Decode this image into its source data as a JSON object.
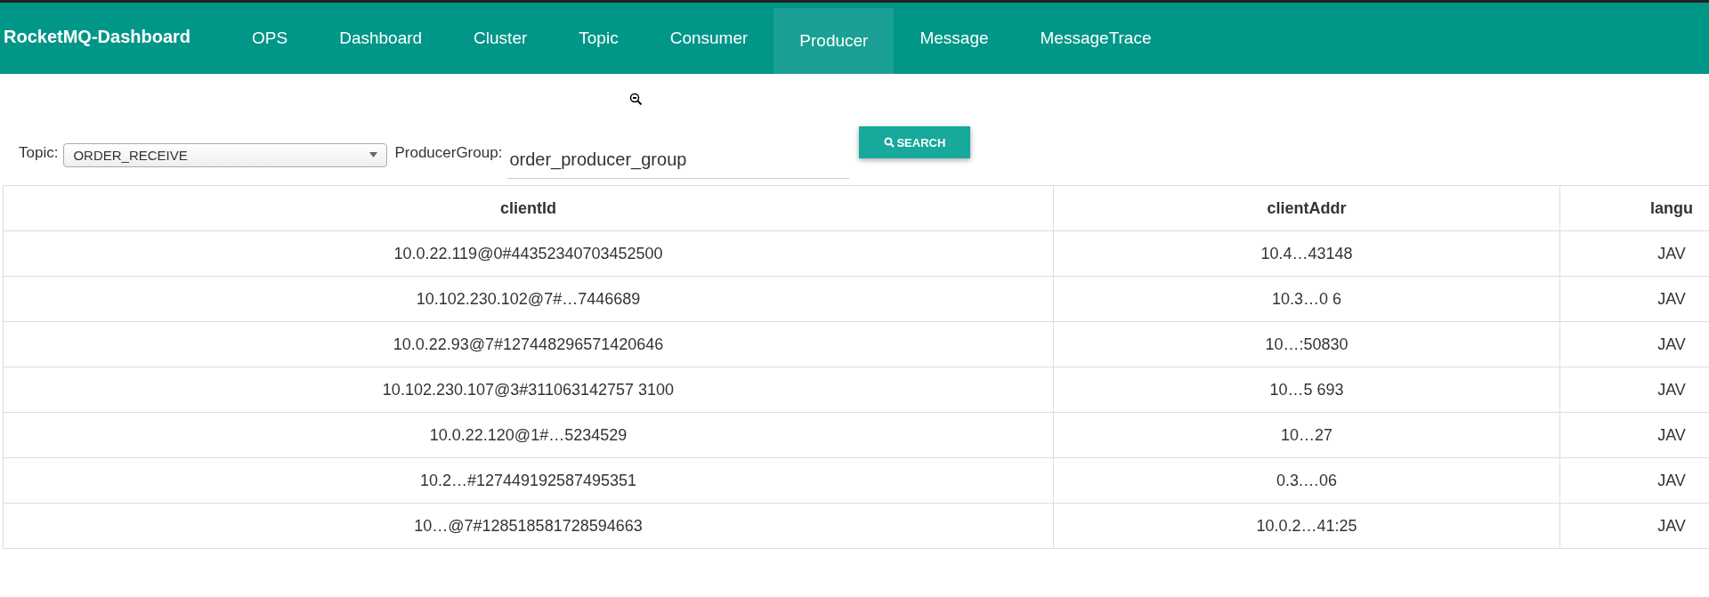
{
  "navbar": {
    "brand": "RocketMQ-Dashboard",
    "items": [
      {
        "label": "OPS",
        "selected": false
      },
      {
        "label": "Dashboard",
        "selected": false
      },
      {
        "label": "Cluster",
        "selected": false
      },
      {
        "label": "Topic",
        "selected": false
      },
      {
        "label": "Consumer",
        "selected": false
      },
      {
        "label": "Producer",
        "selected": true
      },
      {
        "label": "Message",
        "selected": false
      },
      {
        "label": "MessageTrace",
        "selected": false
      }
    ]
  },
  "filters": {
    "topic_label": "Topic:",
    "topic_value": "ORDER_RECEIVE",
    "group_label": "ProducerGroup:",
    "group_value": "order_producer_group",
    "search_button": "SEARCH"
  },
  "table": {
    "columns": [
      "clientId",
      "clientAddr",
      "langu"
    ],
    "rows": [
      [
        "10.0.22.119@0#44352340703452500",
        "10.4…43148",
        "JAV"
      ],
      [
        "10.102.230.102@7#…7446689",
        "10.3…0 6",
        "JAV"
      ],
      [
        "10.0.22.93@7#127448296571420646",
        "10…:50830",
        "JAV"
      ],
      [
        "10.102.230.107@3#311063142757 3100",
        "10…5 693",
        "JAV"
      ],
      [
        "10.0.22.120@1#…5234529",
        "10…27",
        "JAV"
      ],
      [
        "10.2…#127449192587495351",
        "0.3.…06",
        "JAV"
      ],
      [
        "10…@7#128518581728594663",
        "10.0.2…41:25",
        "JAV"
      ]
    ]
  }
}
